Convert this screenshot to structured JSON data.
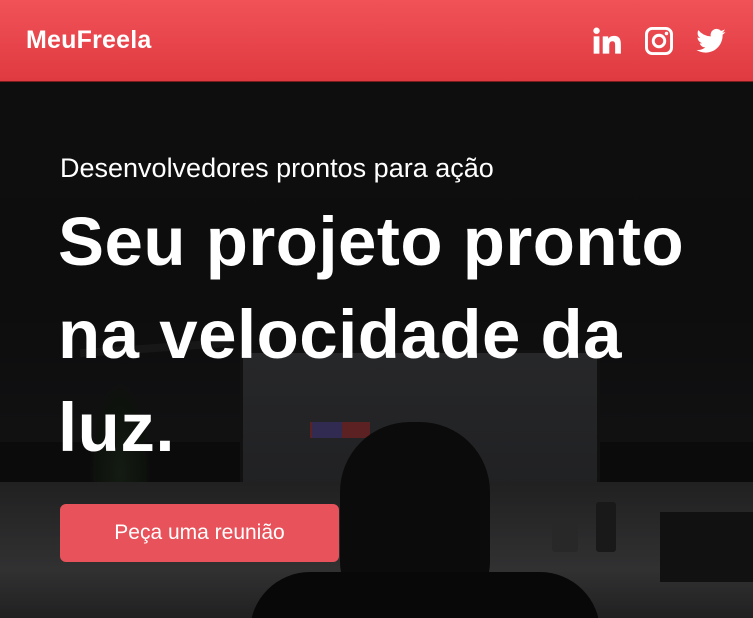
{
  "header": {
    "brand": "MeuFreela",
    "socials": [
      {
        "icon": "linkedin-icon"
      },
      {
        "icon": "instagram-icon"
      },
      {
        "icon": "twitter-icon"
      }
    ]
  },
  "hero": {
    "subtitle": "Desenvolvedores prontos para ação",
    "headline": "Seu projeto pronto na velocidade da luz.",
    "cta_label": "Peça uma reunião"
  },
  "colors": {
    "header_red": "#e8474d",
    "cta_red": "#e8525a",
    "text": "#ffffff"
  }
}
